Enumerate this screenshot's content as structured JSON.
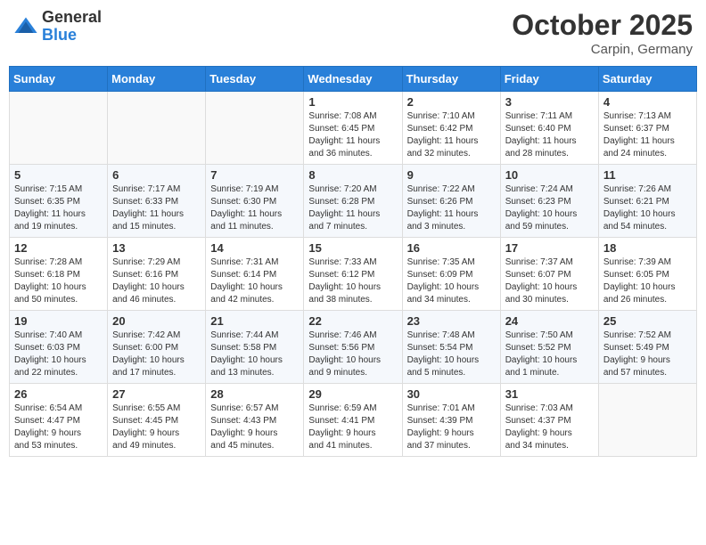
{
  "header": {
    "logo_general": "General",
    "logo_blue": "Blue",
    "month_title": "October 2025",
    "location": "Carpin, Germany"
  },
  "days_of_week": [
    "Sunday",
    "Monday",
    "Tuesday",
    "Wednesday",
    "Thursday",
    "Friday",
    "Saturday"
  ],
  "weeks": [
    [
      {
        "day": "",
        "info": ""
      },
      {
        "day": "",
        "info": ""
      },
      {
        "day": "",
        "info": ""
      },
      {
        "day": "1",
        "info": "Sunrise: 7:08 AM\nSunset: 6:45 PM\nDaylight: 11 hours\nand 36 minutes."
      },
      {
        "day": "2",
        "info": "Sunrise: 7:10 AM\nSunset: 6:42 PM\nDaylight: 11 hours\nand 32 minutes."
      },
      {
        "day": "3",
        "info": "Sunrise: 7:11 AM\nSunset: 6:40 PM\nDaylight: 11 hours\nand 28 minutes."
      },
      {
        "day": "4",
        "info": "Sunrise: 7:13 AM\nSunset: 6:37 PM\nDaylight: 11 hours\nand 24 minutes."
      }
    ],
    [
      {
        "day": "5",
        "info": "Sunrise: 7:15 AM\nSunset: 6:35 PM\nDaylight: 11 hours\nand 19 minutes."
      },
      {
        "day": "6",
        "info": "Sunrise: 7:17 AM\nSunset: 6:33 PM\nDaylight: 11 hours\nand 15 minutes."
      },
      {
        "day": "7",
        "info": "Sunrise: 7:19 AM\nSunset: 6:30 PM\nDaylight: 11 hours\nand 11 minutes."
      },
      {
        "day": "8",
        "info": "Sunrise: 7:20 AM\nSunset: 6:28 PM\nDaylight: 11 hours\nand 7 minutes."
      },
      {
        "day": "9",
        "info": "Sunrise: 7:22 AM\nSunset: 6:26 PM\nDaylight: 11 hours\nand 3 minutes."
      },
      {
        "day": "10",
        "info": "Sunrise: 7:24 AM\nSunset: 6:23 PM\nDaylight: 10 hours\nand 59 minutes."
      },
      {
        "day": "11",
        "info": "Sunrise: 7:26 AM\nSunset: 6:21 PM\nDaylight: 10 hours\nand 54 minutes."
      }
    ],
    [
      {
        "day": "12",
        "info": "Sunrise: 7:28 AM\nSunset: 6:18 PM\nDaylight: 10 hours\nand 50 minutes."
      },
      {
        "day": "13",
        "info": "Sunrise: 7:29 AM\nSunset: 6:16 PM\nDaylight: 10 hours\nand 46 minutes."
      },
      {
        "day": "14",
        "info": "Sunrise: 7:31 AM\nSunset: 6:14 PM\nDaylight: 10 hours\nand 42 minutes."
      },
      {
        "day": "15",
        "info": "Sunrise: 7:33 AM\nSunset: 6:12 PM\nDaylight: 10 hours\nand 38 minutes."
      },
      {
        "day": "16",
        "info": "Sunrise: 7:35 AM\nSunset: 6:09 PM\nDaylight: 10 hours\nand 34 minutes."
      },
      {
        "day": "17",
        "info": "Sunrise: 7:37 AM\nSunset: 6:07 PM\nDaylight: 10 hours\nand 30 minutes."
      },
      {
        "day": "18",
        "info": "Sunrise: 7:39 AM\nSunset: 6:05 PM\nDaylight: 10 hours\nand 26 minutes."
      }
    ],
    [
      {
        "day": "19",
        "info": "Sunrise: 7:40 AM\nSunset: 6:03 PM\nDaylight: 10 hours\nand 22 minutes."
      },
      {
        "day": "20",
        "info": "Sunrise: 7:42 AM\nSunset: 6:00 PM\nDaylight: 10 hours\nand 17 minutes."
      },
      {
        "day": "21",
        "info": "Sunrise: 7:44 AM\nSunset: 5:58 PM\nDaylight: 10 hours\nand 13 minutes."
      },
      {
        "day": "22",
        "info": "Sunrise: 7:46 AM\nSunset: 5:56 PM\nDaylight: 10 hours\nand 9 minutes."
      },
      {
        "day": "23",
        "info": "Sunrise: 7:48 AM\nSunset: 5:54 PM\nDaylight: 10 hours\nand 5 minutes."
      },
      {
        "day": "24",
        "info": "Sunrise: 7:50 AM\nSunset: 5:52 PM\nDaylight: 10 hours\nand 1 minute."
      },
      {
        "day": "25",
        "info": "Sunrise: 7:52 AM\nSunset: 5:49 PM\nDaylight: 9 hours\nand 57 minutes."
      }
    ],
    [
      {
        "day": "26",
        "info": "Sunrise: 6:54 AM\nSunset: 4:47 PM\nDaylight: 9 hours\nand 53 minutes."
      },
      {
        "day": "27",
        "info": "Sunrise: 6:55 AM\nSunset: 4:45 PM\nDaylight: 9 hours\nand 49 minutes."
      },
      {
        "day": "28",
        "info": "Sunrise: 6:57 AM\nSunset: 4:43 PM\nDaylight: 9 hours\nand 45 minutes."
      },
      {
        "day": "29",
        "info": "Sunrise: 6:59 AM\nSunset: 4:41 PM\nDaylight: 9 hours\nand 41 minutes."
      },
      {
        "day": "30",
        "info": "Sunrise: 7:01 AM\nSunset: 4:39 PM\nDaylight: 9 hours\nand 37 minutes."
      },
      {
        "day": "31",
        "info": "Sunrise: 7:03 AM\nSunset: 4:37 PM\nDaylight: 9 hours\nand 34 minutes."
      },
      {
        "day": "",
        "info": ""
      }
    ]
  ]
}
